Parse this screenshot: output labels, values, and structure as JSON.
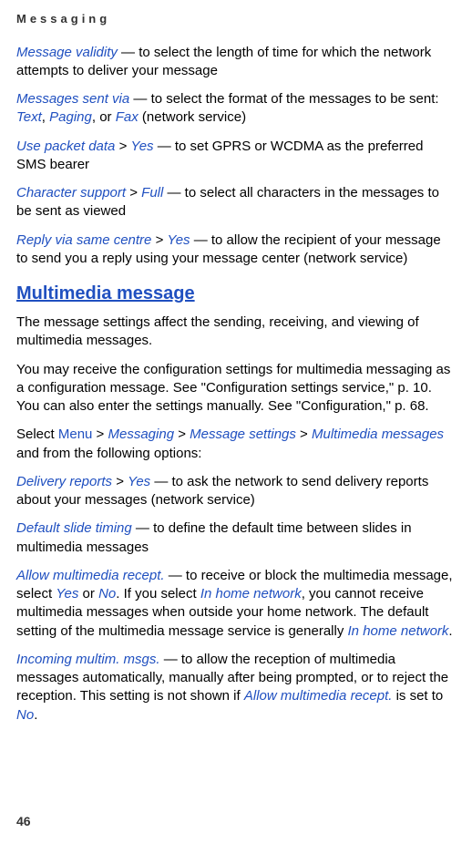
{
  "header": "Messaging",
  "page_number": "46",
  "items": [
    {
      "term": "Message validity",
      "text": " — to select the length of time for which the network attempts to deliver your message"
    },
    {
      "term": "Messages sent via",
      "text_prefix": " — to select the format of the messages to be sent: ",
      "subterms": [
        "Text",
        "Paging",
        "Fax"
      ],
      "joiner": [
        ", ",
        ", or "
      ],
      "text_suffix": " (network service)"
    },
    {
      "term": "Use packet data",
      "sep": " > ",
      "value": "Yes",
      "text": " — to set GPRS or WCDMA as the preferred SMS bearer"
    },
    {
      "term": "Character support",
      "sep": " > ",
      "value": "Full",
      "text": " — to select all characters in the messages to be sent as viewed"
    },
    {
      "term": "Reply via same centre",
      "sep": " > ",
      "value": "Yes",
      "text": " — to allow the recipient of your message to send you a reply using your message center (network service)"
    }
  ],
  "section_title": "Multimedia message",
  "sec_para1": "The message settings affect the sending, receiving, and viewing of multimedia messages.",
  "sec_para2": "You may receive the configuration settings for multimedia messaging as a configuration message. See \"Configuration settings service,\" p. 10. You can also enter the settings manually. See \"Configuration,\" p. 68.",
  "sec_select": {
    "prefix": "Select ",
    "path": [
      "Menu",
      "Messaging",
      "Message settings",
      "Multimedia messages"
    ],
    "suffix": " and from the following options:"
  },
  "options": [
    {
      "term": "Delivery reports",
      "sep": " > ",
      "value": "Yes",
      "text": " — to ask the network to send delivery reports about your messages (network service)"
    },
    {
      "term": "Default slide timing",
      "text": " — to define the default time between slides in multimedia messages"
    }
  ],
  "allow_recept": {
    "term": "Allow multimedia recept.",
    "p1": " — to receive or block the multimedia message, select ",
    "yes": "Yes",
    "or": " or ",
    "no": "No",
    "p2": ". If you select ",
    "home1": "In home network",
    "p3": ", you cannot receive multimedia messages when outside your home network. The default setting of the multimedia message service is generally ",
    "home2": "In home network",
    "p4": "."
  },
  "incoming": {
    "term": "Incoming multim. msgs.",
    "p1": " — to allow the reception of multimedia messages automatically, manually after being prompted, or to reject the reception. This setting is not shown if ",
    "ref": "Allow multimedia recept.",
    "p2": " is set to ",
    "no": "No",
    "p3": "."
  }
}
